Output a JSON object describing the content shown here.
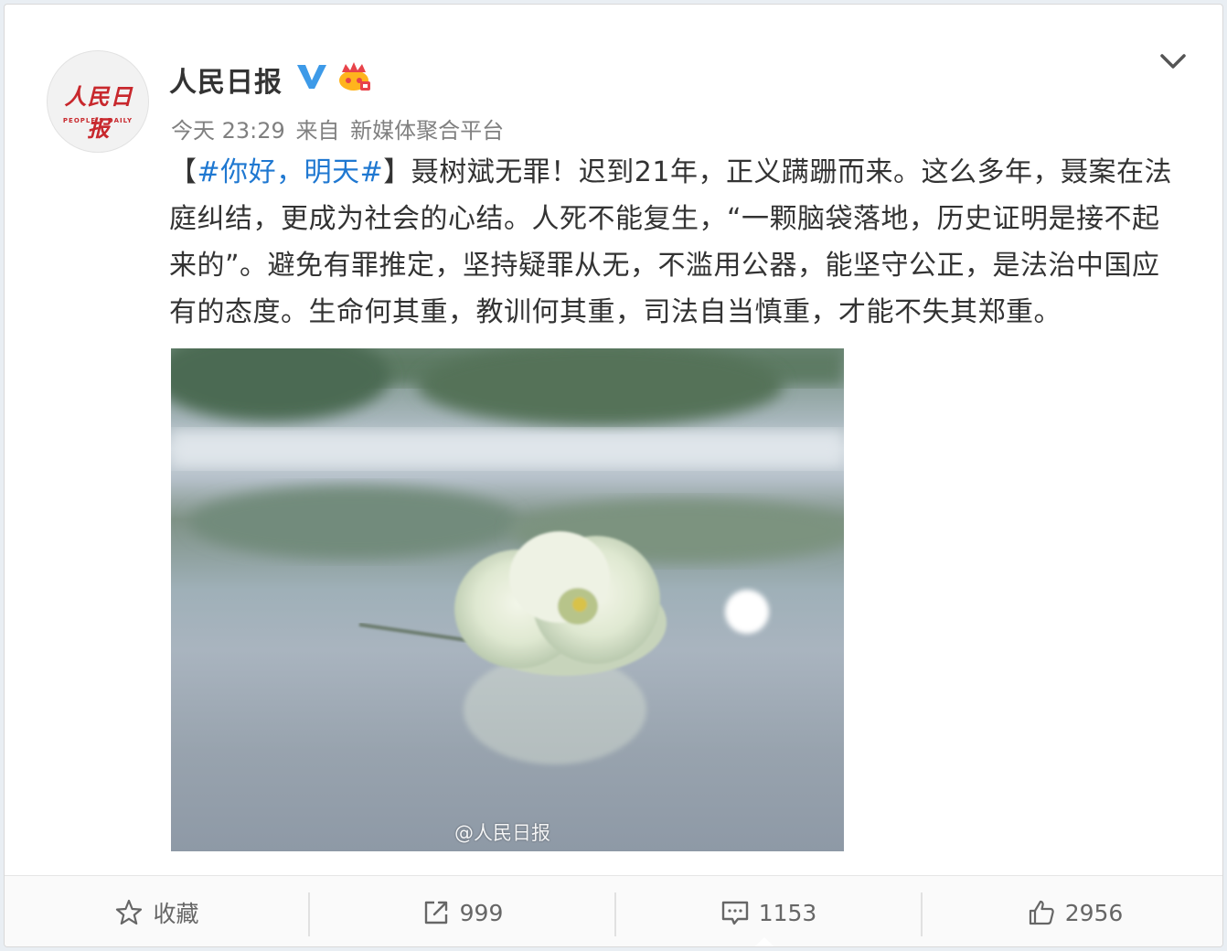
{
  "post": {
    "username": "人民日报",
    "avatar": {
      "logo_text": "人民日报",
      "subtitle": "PEOPLE'S DAILY"
    },
    "time": "今天 23:29",
    "source_prefix": "来自",
    "source": "新媒体聚合平台",
    "text": {
      "bracket_open": "【",
      "hashtag": "#你好，明天#",
      "bracket_close": "】",
      "body": "聂树斌无罪！迟到21年，正义蹒跚而来。这么多年，聂案在法庭纠结，更成为社会的心结。人死不能复生，“一颗脑袋落地，历史证明是接不起来的”。避免有罪推定，坚持疑罪从无，不滥用公器，能坚守公正，是法治中国应有的态度。生命何其重，教训何其重，司法自当慎重，才能不失其郑重。"
    },
    "image_watermark": "@人民日报"
  },
  "actions": {
    "favorite": {
      "label": "收藏",
      "icon": "star-icon"
    },
    "repost": {
      "count": "999",
      "icon": "share-icon"
    },
    "comment": {
      "count": "1153",
      "icon": "comment-icon"
    },
    "like": {
      "count": "2956",
      "icon": "thumbs-up-icon"
    }
  },
  "colors": {
    "hashtag": "#1f78d1",
    "verified": "#3d9ae8",
    "brand_red": "#c8282d"
  }
}
